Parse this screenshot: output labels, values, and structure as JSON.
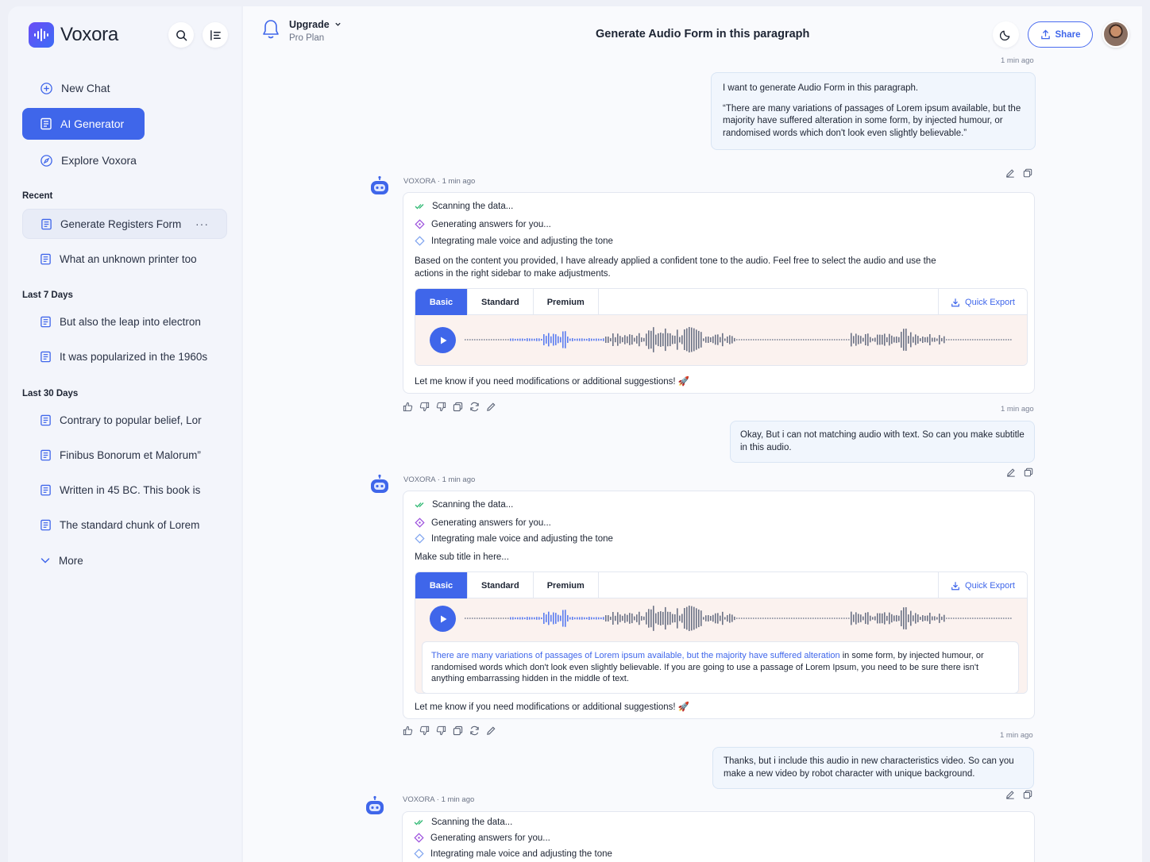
{
  "app": {
    "name": "Voxora",
    "brand_color": "#3f66ea"
  },
  "sidebar": {
    "new_chat": "New Chat",
    "ai_generator": "AI Generator",
    "explore": "Explore Voxora",
    "recent_title": "Recent",
    "recent": [
      "Generate Registers Form",
      "What an unknown printer too"
    ],
    "last7_title": "Last 7 Days",
    "last7": [
      "But also the leap into electron",
      "It was popularized in the 1960s"
    ],
    "last30_title": "Last 30 Days",
    "last30": [
      "Contrary to popular belief, Lor",
      "Finibus Bonorum et Malorum”",
      "Written in 45 BC. This book is",
      "The standard chunk of Lorem"
    ],
    "more": "More",
    "item_menu": "···"
  },
  "topbar": {
    "upgrade_title": "Upgrade",
    "upgrade_plan": "Pro Plan",
    "page_title": "Generate Audio Form in this paragraph",
    "share": "Share"
  },
  "chat": {
    "bot_label": "VOXORA · 1 min ago",
    "timestamp": "1 min ago",
    "steps": [
      "Scanning the data...",
      "Generating answers for you...",
      "Integrating male voice and adjusting the tone"
    ],
    "tabs": [
      "Basic",
      "Standard",
      "Premium"
    ],
    "quick_export": "Quick Export",
    "followup": "Let me know if you need modifications or additional suggestions! 🚀",
    "user1_p1": "I want to generate Audio Form in this paragraph.",
    "user1_p2": "“There are many variations of passages of Lorem ipsum available, but the majority have suffered alteration in some form, by injected humour, or randomised words which don't look even slightly believable.”",
    "bot1_text": "Based on the content you provided, I have already applied a confident tone to the audio. Feel free to select the audio and use the actions in the right sidebar to make adjustments.",
    "user2": "Okay, But i can not matching audio with text. So can you make subtitle in this audio.",
    "bot2_text": "Make sub title in here...",
    "subtitle_hl": "There are many variations of passages of Lorem ipsum available, but the majority have suffered alteration",
    "subtitle_rest": " in some form, by injected humour, or randomised words which don't look even slightly believable. If you are going to use a passage of Lorem Ipsum, you need to be sure there isn't anything embarrassing hidden in the middle of text.",
    "user3": "Thanks, but i include this audio in new characteristics video. So can you make a new video by robot character with unique background."
  }
}
